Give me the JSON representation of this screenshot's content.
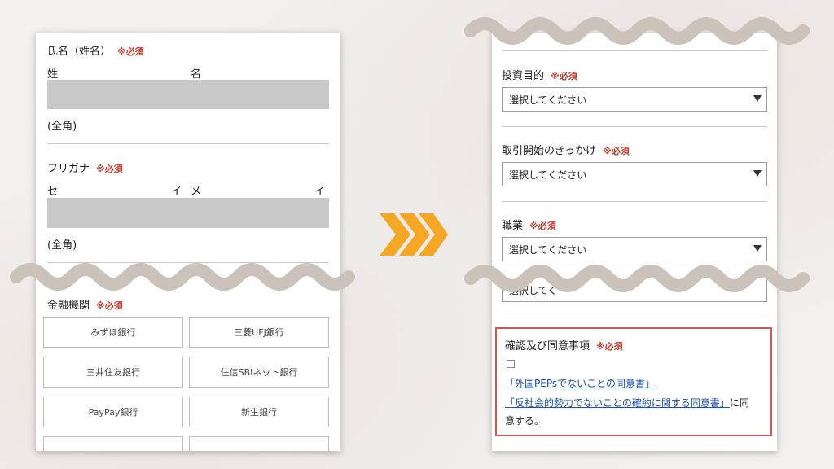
{
  "left_form": {
    "name": {
      "label": "氏名（姓名）",
      "required": "※必須",
      "last_label": "姓",
      "first_label": "名",
      "note": "(全角)"
    },
    "furigana": {
      "label": "フリガナ",
      "required": "※必須",
      "last_label_1": "セ",
      "last_label_2": "イ",
      "first_label_1": "メ",
      "first_label_2": "イ",
      "note": "(全角)"
    },
    "bank": {
      "label": "金融機関",
      "required": "※必須",
      "options": [
        "みずほ銀行",
        "三菱UFJ銀行",
        "三井住友銀行",
        "住信SBIネット銀行",
        "PayPay銀行",
        "新生銀行"
      ]
    }
  },
  "right_form": {
    "fields": [
      {
        "label": "投資目的",
        "required": "※必須",
        "selected": "選択してください"
      },
      {
        "label": "取引開始のきっかけ",
        "required": "※必須",
        "selected": "選択してください"
      },
      {
        "label": "職業",
        "required": "※必須",
        "selected": "選択してください"
      }
    ],
    "partial_select": "選択してく",
    "consent": {
      "label": "確認及び同意事項",
      "required": "※必須",
      "link1": "「外国PEPsでないことの同意書」",
      "link2": "「反社会的勢力でないことの確約に関する同意書」",
      "suffix1": "に同",
      "suffix2": "意する。"
    }
  },
  "colors": {
    "wave": "#cbc2b9",
    "arrow": "#f5a623",
    "required": "#c0392b",
    "highlight_border": "#d9534f",
    "link": "#1a4fb3"
  }
}
